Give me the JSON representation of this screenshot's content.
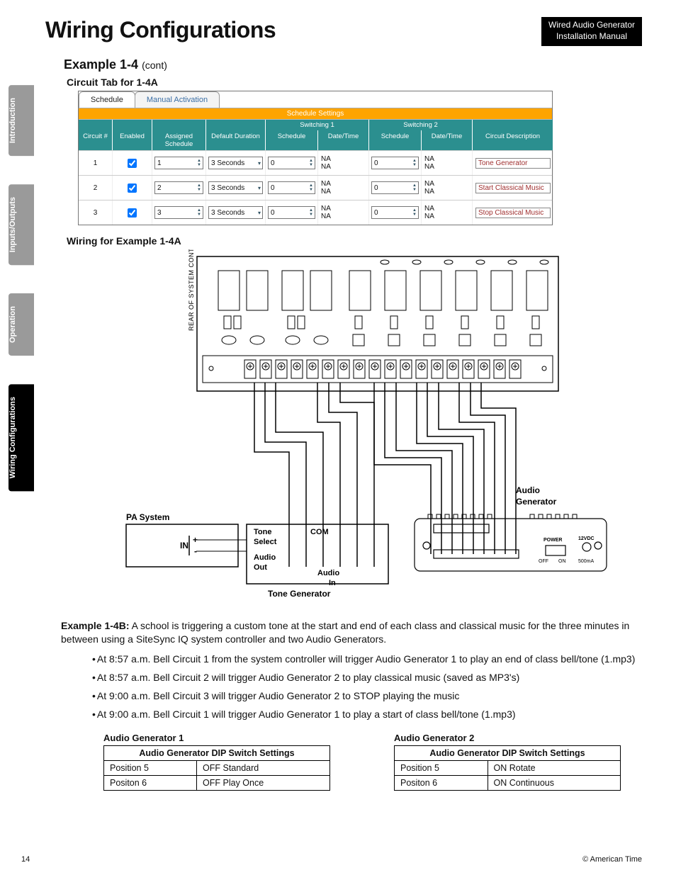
{
  "header": {
    "title": "Wiring Configurations",
    "manual_line1": "Wired Audio Generator",
    "manual_line2": "Installation Manual"
  },
  "side_tabs": [
    "Introduction",
    "Inputs/Outputs",
    "Operation",
    "Wiring Configurations"
  ],
  "section": {
    "title_main": "Example 1-4",
    "title_cont": "(cont)",
    "circuit_heading": "Circuit Tab for 1-4A",
    "wiring_heading": "Wiring for Example 1-4A"
  },
  "ui": {
    "tabs": [
      "Schedule",
      "Manual Activation"
    ],
    "banner": "Schedule Settings",
    "top_group_headers": [
      "",
      "",
      "",
      "",
      "Switching 1",
      "Switching 2",
      ""
    ],
    "col_headers": [
      "Circuit #",
      "Enabled",
      "Assigned Schedule",
      "Default Duration",
      "Schedule",
      "Date/Time",
      "Schedule",
      "Date/Time",
      "Circuit Description"
    ],
    "rows": [
      {
        "n": "1",
        "enabled": true,
        "assigned": "1",
        "duration": "3 Seconds",
        "s1": "0",
        "dt1": "NA",
        "s2": "0",
        "dt2": "NA",
        "desc": "Tone Generator"
      },
      {
        "n": "2",
        "enabled": true,
        "assigned": "2",
        "duration": "3 Seconds",
        "s1": "0",
        "dt1": "NA",
        "s2": "0",
        "dt2": "NA",
        "desc": "Start Classical Music"
      },
      {
        "n": "3",
        "enabled": true,
        "assigned": "3",
        "duration": "3 Seconds",
        "s1": "0",
        "dt1": "NA",
        "s2": "0",
        "dt2": "NA",
        "desc": "Stop Classical Music"
      }
    ]
  },
  "diagram": {
    "rear_label": "REAR OF SYSTEM CONTROLLER",
    "pa_system": "PA System",
    "in_label": "IN",
    "plus": "+",
    "minus": "-",
    "tone_select": "Tone Select",
    "com": "COM",
    "audio_out": "Audio Out",
    "audio_in": "Audio In",
    "tone_gen": "Tone Generator",
    "audio_gen_label1": "Audio",
    "audio_gen_label2": "Generator",
    "power": "POWER",
    "off": "OFF",
    "on": "ON",
    "vdc": "12VDC",
    "ma": "500mA"
  },
  "example_b": {
    "bold": "Example 1-4B:",
    "body": " A school is triggering a custom tone at the start and end of each class and classical music for the three minutes in between using a SiteSync IQ system controller and two Audio Generators.",
    "bullets": [
      "At 8:57 a.m. Bell Circuit 1 from the system controller will trigger Audio Generator 1 to play an end of class bell/tone (1.mp3)",
      "At 8:57 a.m. Bell Circuit 2 will trigger Audio Generator 2 to play classical music (saved as MP3's)",
      "At 9:00 a.m. Bell Circuit 3 will trigger Audio Generator 2 to STOP playing the music",
      "At 9:00 a.m. Bell Circuit 1 will trigger Audio Generator 1 to play a start of class bell/tone (1.mp3)"
    ]
  },
  "dip": {
    "t1_title": "Audio Generator 1",
    "t2_title": "Audio Generator 2",
    "table_header": "Audio Generator DIP Switch Settings",
    "t1_rows": [
      [
        "Position 5",
        "OFF Standard"
      ],
      [
        "Positon 6",
        "OFF Play Once"
      ]
    ],
    "t2_rows": [
      [
        "Position 5",
        "ON Rotate"
      ],
      [
        "Positon 6",
        "ON Continuous"
      ]
    ]
  },
  "footer": {
    "page": "14",
    "copyright": "© American Time"
  }
}
